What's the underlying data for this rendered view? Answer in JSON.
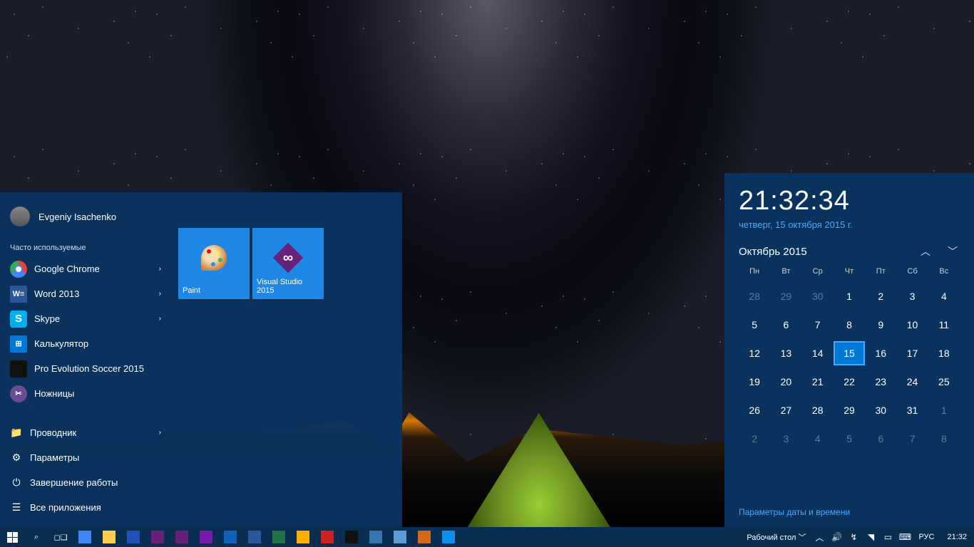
{
  "user": {
    "name": "Evgeniy Isachenko"
  },
  "start": {
    "frequent_label": "Часто используемые",
    "apps": [
      {
        "label": "Google Chrome",
        "icon": "chrome-ic",
        "arrow": true
      },
      {
        "label": "Word 2013",
        "icon": "word-ic",
        "txt": "W≡",
        "arrow": true
      },
      {
        "label": "Skype",
        "icon": "skype-ic",
        "txt": "S",
        "arrow": true
      },
      {
        "label": "Калькулятор",
        "icon": "calc-ic",
        "txt": "⊞"
      },
      {
        "label": "Pro Evolution Soccer 2015",
        "icon": "pes-ic"
      },
      {
        "label": "Ножницы",
        "icon": "scis-ic",
        "txt": "✂"
      }
    ],
    "sys": [
      {
        "label": "Проводник",
        "icon": "📁",
        "arrow": true
      },
      {
        "label": "Параметры",
        "icon": "⚙"
      },
      {
        "label": "Завершение работы",
        "icon": "⏻"
      },
      {
        "label": "Все приложения",
        "icon": "☰"
      }
    ],
    "tiles": [
      {
        "label": "Paint",
        "kind": "paint"
      },
      {
        "label": "Visual Studio 2015",
        "kind": "vs"
      }
    ]
  },
  "calendar": {
    "time": "21:32:34",
    "full_date": "четверг, 15 октября 2015 г.",
    "month": "Октябрь 2015",
    "dow": [
      "Пн",
      "Вт",
      "Ср",
      "Чт",
      "Пт",
      "Сб",
      "Вс"
    ],
    "grid": [
      {
        "d": 28,
        "o": 1
      },
      {
        "d": 29,
        "o": 1
      },
      {
        "d": 30,
        "o": 1
      },
      {
        "d": 1
      },
      {
        "d": 2
      },
      {
        "d": 3
      },
      {
        "d": 4
      },
      {
        "d": 5
      },
      {
        "d": 6
      },
      {
        "d": 7
      },
      {
        "d": 8
      },
      {
        "d": 9
      },
      {
        "d": 10
      },
      {
        "d": 11
      },
      {
        "d": 12
      },
      {
        "d": 13
      },
      {
        "d": 14
      },
      {
        "d": 15,
        "t": 1
      },
      {
        "d": 16
      },
      {
        "d": 17
      },
      {
        "d": 18
      },
      {
        "d": 19
      },
      {
        "d": 20
      },
      {
        "d": 21
      },
      {
        "d": 22
      },
      {
        "d": 23
      },
      {
        "d": 24
      },
      {
        "d": 25
      },
      {
        "d": 26
      },
      {
        "d": 27
      },
      {
        "d": 28
      },
      {
        "d": 29
      },
      {
        "d": 30
      },
      {
        "d": 31
      },
      {
        "d": 1,
        "o": 1
      },
      {
        "d": 2,
        "o": 1
      },
      {
        "d": 3,
        "o": 1
      },
      {
        "d": 4,
        "o": 1
      },
      {
        "d": 5,
        "o": 1
      },
      {
        "d": 6,
        "o": 1
      },
      {
        "d": 7,
        "o": 1
      },
      {
        "d": 8,
        "o": 1
      }
    ],
    "settings_link": "Параметры даты и времени"
  },
  "taskbar": {
    "desktop_label": "Рабочий стол",
    "lang": "РУС",
    "clock": "21:32",
    "pinned_icons": [
      "chrome",
      "explorer",
      "save",
      "vs",
      "vs2",
      "onenote",
      "calc",
      "word",
      "excel",
      "hedge",
      "x64",
      "cmd",
      "py",
      "task",
      "paint",
      "tv"
    ]
  },
  "pin_colors": {
    "chrome": "#4285f4",
    "explorer": "#ffcc4d",
    "save": "#1e52b7",
    "vs": "#68217a",
    "vs2": "#68217a",
    "onenote": "#7719aa",
    "calc": "#1161b8",
    "word": "#2b579a",
    "excel": "#217346",
    "hedge": "#ffb000",
    "x64": "#cc2222",
    "cmd": "#111",
    "py": "#3776ab",
    "task": "#5e9cd3",
    "paint": "#d2691e",
    "tv": "#0e8ee9"
  }
}
